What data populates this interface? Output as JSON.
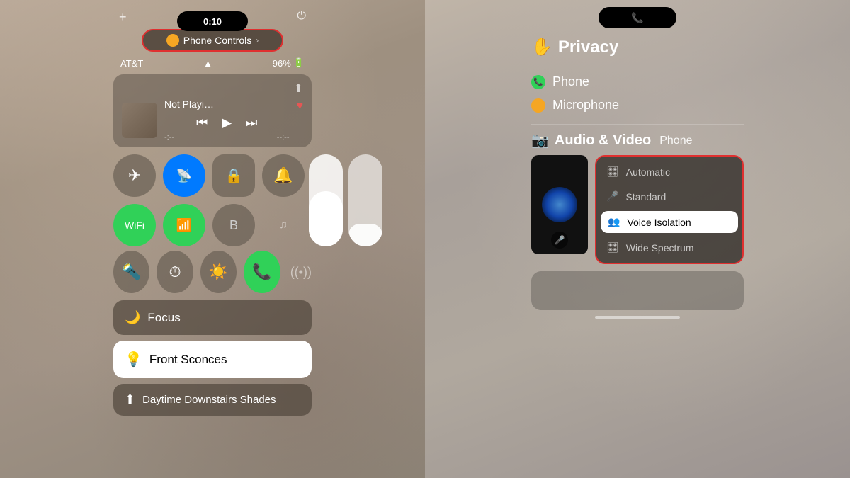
{
  "left_phone": {
    "time": "0:10",
    "carrier": "AT&T",
    "battery": "96%",
    "controls_banner": {
      "label": "Phone  Controls",
      "arrow": "›"
    },
    "now_playing": {
      "track": "Not Playi…",
      "time_start": "-:--",
      "time_end": "--:--"
    },
    "focus": {
      "label": "Focus"
    },
    "sconces": {
      "label": "Front Sconces"
    },
    "daytime": {
      "label": "Daytime Downstairs Shades"
    }
  },
  "right_phone": {
    "privacy_title": "Privacy",
    "privacy_hand": "✋",
    "items": [
      {
        "icon": "phone",
        "color": "green",
        "label": "Phone"
      },
      {
        "icon": "mic",
        "color": "orange",
        "label": "Microphone"
      }
    ],
    "audio_video": {
      "title": "Audio & Video",
      "subtitle": "Phone"
    },
    "audio_options": [
      {
        "icon": "🎛",
        "label": "Automatic",
        "selected": false
      },
      {
        "icon": "🎤",
        "label": "Standard",
        "selected": false
      },
      {
        "icon": "👥",
        "label": "Voice Isolation",
        "selected": true
      },
      {
        "icon": "🎛",
        "label": "Wide Spectrum",
        "selected": false
      }
    ]
  },
  "icons": {
    "plus": "+",
    "power": "⏻",
    "airplane": "✈",
    "wifi": "wifi",
    "bluetooth": "B",
    "signal": "📶",
    "lock": "🔒",
    "bell": "🔔",
    "moon": "🌙",
    "bulb": "💡",
    "shade": "⬆",
    "flashlight": "🔦",
    "timer": "⏱",
    "sun": "☀",
    "phone_green": "📞",
    "airplay": "⬆",
    "note": "♫"
  }
}
